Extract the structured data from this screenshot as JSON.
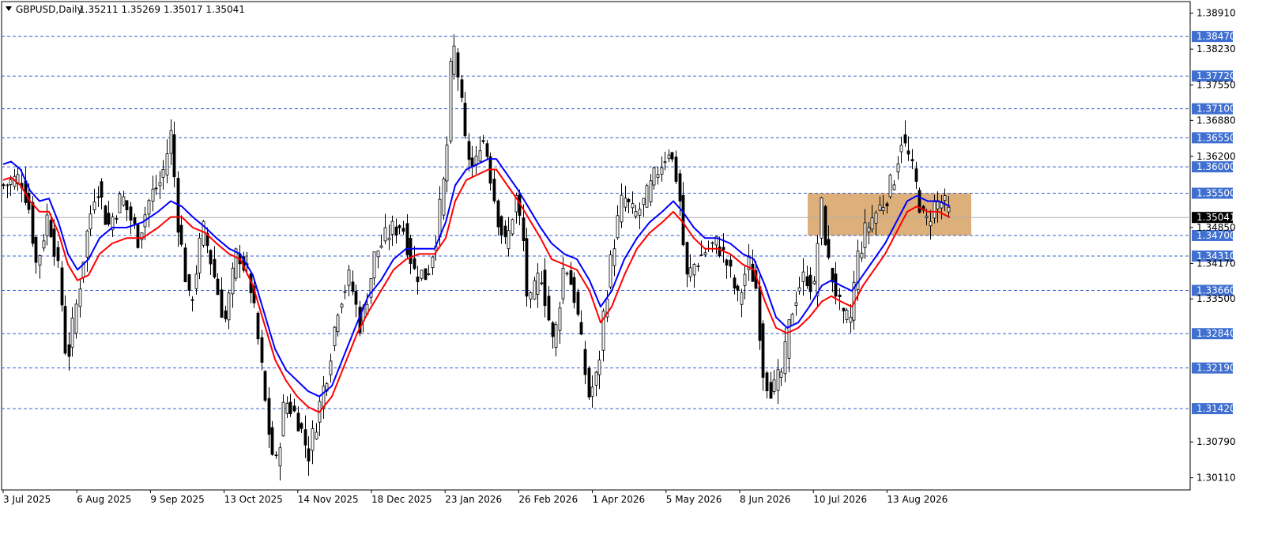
{
  "header": {
    "symbol": "GBPUSD,Daily",
    "ohlc": "1.35211 1.35269 1.35017 1.35041"
  },
  "chart_data": {
    "type": "candlestick",
    "title": "GBPUSD,Daily",
    "ylim": [
      1.2985,
      1.3915
    ],
    "y_ticks": [
      1.3891,
      1.3823,
      1.3755,
      1.3688,
      1.362,
      1.3485,
      1.3417,
      1.335,
      1.3079,
      1.3011
    ],
    "y_tick_labels": [
      "1.38910",
      "1.38230",
      "1.37550",
      "1.36880",
      "1.36200",
      "1.34850",
      "1.34170",
      "1.33500",
      "1.30790",
      "1.30110"
    ],
    "x_tick_labels": [
      "3 Jul 2025",
      "6 Aug 2025",
      "9 Sep 2025",
      "13 Oct 2025",
      "14 Nov 2025",
      "18 Dec 2025",
      "23 Jan 2026",
      "26 Feb 2026",
      "1 Apr 2026",
      "5 May 2026",
      "8 Jun 2026",
      "10 Jul 2026",
      "13 Aug 2026"
    ],
    "horizontal_levels": [
      1.3847,
      1.3772,
      1.371,
      1.3655,
      1.36,
      1.355,
      1.347,
      1.3431,
      1.3366,
      1.3284,
      1.3219,
      1.3142
    ],
    "horizontal_level_labels": [
      "1.38470",
      "1.37720",
      "1.37100",
      "1.36550",
      "1.36000",
      "1.35500",
      "1.34700",
      "1.34310",
      "1.33660",
      "1.32840",
      "1.32190",
      "1.31420"
    ],
    "current_price": 1.35041,
    "current_price_label": "1.35041",
    "zone": {
      "low": 1.347,
      "high": 1.355,
      "color": "#d9a66b"
    },
    "close_path": [
      [
        0,
        1.3565
      ],
      [
        14,
        1.3575
      ],
      [
        22,
        1.358
      ],
      [
        32,
        1.3525
      ],
      [
        42,
        1.341
      ],
      [
        56,
        1.351
      ],
      [
        64,
        1.3455
      ],
      [
        72,
        1.337
      ],
      [
        80,
        1.3225
      ],
      [
        96,
        1.3375
      ],
      [
        104,
        1.346
      ],
      [
        118,
        1.3575
      ],
      [
        132,
        1.3485
      ],
      [
        150,
        1.3545
      ],
      [
        170,
        1.3465
      ],
      [
        186,
        1.3545
      ],
      [
        200,
        1.3575
      ],
      [
        212,
        1.3665
      ],
      [
        220,
        1.3505
      ],
      [
        236,
        1.333
      ],
      [
        252,
        1.3485
      ],
      [
        262,
        1.3425
      ],
      [
        280,
        1.3305
      ],
      [
        296,
        1.3445
      ],
      [
        312,
        1.338
      ],
      [
        324,
        1.325
      ],
      [
        334,
        1.3115
      ],
      [
        344,
        1.3025
      ],
      [
        356,
        1.316
      ],
      [
        372,
        1.3125
      ],
      [
        386,
        1.3055
      ],
      [
        398,
        1.3135
      ],
      [
        410,
        1.3215
      ],
      [
        424,
        1.3345
      ],
      [
        438,
        1.339
      ],
      [
        452,
        1.3295
      ],
      [
        470,
        1.3435
      ],
      [
        488,
        1.3475
      ],
      [
        504,
        1.3495
      ],
      [
        520,
        1.34
      ],
      [
        536,
        1.3395
      ],
      [
        548,
        1.3475
      ],
      [
        560,
        1.3605
      ],
      [
        568,
        1.3845
      ],
      [
        576,
        1.3765
      ],
      [
        584,
        1.3645
      ],
      [
        596,
        1.3585
      ],
      [
        604,
        1.3665
      ],
      [
        612,
        1.3625
      ],
      [
        624,
        1.3515
      ],
      [
        636,
        1.3445
      ],
      [
        648,
        1.3545
      ],
      [
        658,
        1.3455
      ],
      [
        664,
        1.3325
      ],
      [
        680,
        1.3405
      ],
      [
        696,
        1.3255
      ],
      [
        710,
        1.3425
      ],
      [
        724,
        1.3345
      ],
      [
        740,
        1.3165
      ],
      [
        752,
        1.3205
      ],
      [
        760,
        1.3335
      ],
      [
        772,
        1.3455
      ],
      [
        784,
        1.3545
      ],
      [
        798,
        1.3505
      ],
      [
        812,
        1.3535
      ],
      [
        828,
        1.3595
      ],
      [
        842,
        1.3635
      ],
      [
        854,
        1.3565
      ],
      [
        864,
        1.3385
      ],
      [
        876,
        1.342
      ],
      [
        890,
        1.3445
      ],
      [
        904,
        1.3455
      ],
      [
        916,
        1.3415
      ],
      [
        930,
        1.3345
      ],
      [
        942,
        1.342
      ],
      [
        952,
        1.3375
      ],
      [
        962,
        1.3205
      ],
      [
        974,
        1.3175
      ],
      [
        986,
        1.3215
      ],
      [
        996,
        1.332
      ],
      [
        1006,
        1.3375
      ],
      [
        1016,
        1.3395
      ],
      [
        1026,
        1.3365
      ],
      [
        1034,
        1.3535
      ],
      [
        1044,
        1.3415
      ],
      [
        1052,
        1.3375
      ],
      [
        1062,
        1.3305
      ],
      [
        1072,
        1.3315
      ],
      [
        1080,
        1.3425
      ],
      [
        1090,
        1.3475
      ],
      [
        1100,
        1.3505
      ],
      [
        1114,
        1.3535
      ],
      [
        1126,
        1.3575
      ],
      [
        1136,
        1.3655
      ],
      [
        1146,
        1.3615
      ],
      [
        1156,
        1.3555
      ],
      [
        1166,
        1.3485
      ],
      [
        1176,
        1.3525
      ],
      [
        1188,
        1.3535
      ],
      [
        1198,
        1.3504
      ]
    ],
    "series": [
      {
        "color": "#0000ff",
        "values": [
          [
            0,
            1.3605
          ],
          [
            10,
            1.361
          ],
          [
            22,
            1.3595
          ],
          [
            34,
            1.3555
          ],
          [
            46,
            1.3535
          ],
          [
            58,
            1.354
          ],
          [
            70,
            1.3495
          ],
          [
            82,
            1.3435
          ],
          [
            94,
            1.3405
          ],
          [
            108,
            1.3425
          ],
          [
            122,
            1.3465
          ],
          [
            138,
            1.3485
          ],
          [
            156,
            1.3485
          ],
          [
            176,
            1.3495
          ],
          [
            196,
            1.3515
          ],
          [
            212,
            1.3535
          ],
          [
            226,
            1.3525
          ],
          [
            240,
            1.3505
          ],
          [
            256,
            1.3485
          ],
          [
            270,
            1.3465
          ],
          [
            286,
            1.3445
          ],
          [
            300,
            1.3435
          ],
          [
            316,
            1.3395
          ],
          [
            330,
            1.3325
          ],
          [
            344,
            1.3255
          ],
          [
            358,
            1.3215
          ],
          [
            372,
            1.3195
          ],
          [
            386,
            1.3175
          ],
          [
            400,
            1.3165
          ],
          [
            416,
            1.3185
          ],
          [
            432,
            1.3245
          ],
          [
            448,
            1.3305
          ],
          [
            462,
            1.3355
          ],
          [
            478,
            1.3385
          ],
          [
            494,
            1.3425
          ],
          [
            510,
            1.3445
          ],
          [
            526,
            1.3445
          ],
          [
            546,
            1.3445
          ],
          [
            560,
            1.3495
          ],
          [
            572,
            1.3565
          ],
          [
            586,
            1.3595
          ],
          [
            600,
            1.3605
          ],
          [
            614,
            1.3615
          ],
          [
            624,
            1.3615
          ],
          [
            638,
            1.3585
          ],
          [
            652,
            1.3555
          ],
          [
            664,
            1.3525
          ],
          [
            680,
            1.3485
          ],
          [
            694,
            1.3455
          ],
          [
            710,
            1.3435
          ],
          [
            726,
            1.3425
          ],
          [
            742,
            1.3385
          ],
          [
            756,
            1.3335
          ],
          [
            770,
            1.3365
          ],
          [
            786,
            1.3425
          ],
          [
            802,
            1.3465
          ],
          [
            818,
            1.3495
          ],
          [
            834,
            1.3515
          ],
          [
            848,
            1.3535
          ],
          [
            860,
            1.3515
          ],
          [
            874,
            1.3485
          ],
          [
            888,
            1.3465
          ],
          [
            904,
            1.3465
          ],
          [
            920,
            1.3455
          ],
          [
            936,
            1.3435
          ],
          [
            950,
            1.3425
          ],
          [
            964,
            1.3375
          ],
          [
            978,
            1.3315
          ],
          [
            992,
            1.3295
          ],
          [
            1006,
            1.3305
          ],
          [
            1020,
            1.3335
          ],
          [
            1036,
            1.3375
          ],
          [
            1048,
            1.3385
          ],
          [
            1060,
            1.3375
          ],
          [
            1074,
            1.3365
          ],
          [
            1088,
            1.3395
          ],
          [
            1102,
            1.3425
          ],
          [
            1116,
            1.3455
          ],
          [
            1130,
            1.3495
          ],
          [
            1144,
            1.3535
          ],
          [
            1156,
            1.3545
          ],
          [
            1170,
            1.3535
          ],
          [
            1184,
            1.3535
          ],
          [
            1198,
            1.3525
          ]
        ]
      },
      {
        "color": "#ff0000",
        "values": [
          [
            0,
            1.3575
          ],
          [
            10,
            1.358
          ],
          [
            22,
            1.3565
          ],
          [
            34,
            1.3535
          ],
          [
            46,
            1.3515
          ],
          [
            58,
            1.3515
          ],
          [
            70,
            1.3475
          ],
          [
            82,
            1.3415
          ],
          [
            94,
            1.3385
          ],
          [
            108,
            1.3395
          ],
          [
            122,
            1.3435
          ],
          [
            138,
            1.3455
          ],
          [
            156,
            1.3465
          ],
          [
            176,
            1.3465
          ],
          [
            196,
            1.3485
          ],
          [
            212,
            1.3505
          ],
          [
            226,
            1.3505
          ],
          [
            240,
            1.3485
          ],
          [
            256,
            1.3475
          ],
          [
            270,
            1.3455
          ],
          [
            286,
            1.3435
          ],
          [
            300,
            1.3425
          ],
          [
            316,
            1.3375
          ],
          [
            330,
            1.3305
          ],
          [
            344,
            1.3235
          ],
          [
            358,
            1.3195
          ],
          [
            372,
            1.3165
          ],
          [
            386,
            1.3145
          ],
          [
            400,
            1.3135
          ],
          [
            416,
            1.3165
          ],
          [
            432,
            1.3225
          ],
          [
            448,
            1.3285
          ],
          [
            462,
            1.3325
          ],
          [
            478,
            1.3365
          ],
          [
            494,
            1.3405
          ],
          [
            510,
            1.3425
          ],
          [
            526,
            1.3435
          ],
          [
            546,
            1.3435
          ],
          [
            560,
            1.3465
          ],
          [
            572,
            1.3535
          ],
          [
            586,
            1.3575
          ],
          [
            600,
            1.3585
          ],
          [
            614,
            1.3595
          ],
          [
            624,
            1.3595
          ],
          [
            638,
            1.3565
          ],
          [
            652,
            1.3535
          ],
          [
            664,
            1.3505
          ],
          [
            680,
            1.3465
          ],
          [
            694,
            1.3425
          ],
          [
            710,
            1.3415
          ],
          [
            726,
            1.3405
          ],
          [
            742,
            1.3365
          ],
          [
            756,
            1.3305
          ],
          [
            770,
            1.3335
          ],
          [
            786,
            1.3395
          ],
          [
            802,
            1.3445
          ],
          [
            818,
            1.3475
          ],
          [
            834,
            1.3495
          ],
          [
            848,
            1.3515
          ],
          [
            860,
            1.3495
          ],
          [
            874,
            1.3465
          ],
          [
            888,
            1.3445
          ],
          [
            904,
            1.3445
          ],
          [
            920,
            1.3435
          ],
          [
            936,
            1.3415
          ],
          [
            950,
            1.3405
          ],
          [
            964,
            1.3345
          ],
          [
            978,
            1.3295
          ],
          [
            992,
            1.3285
          ],
          [
            1006,
            1.3295
          ],
          [
            1020,
            1.3315
          ],
          [
            1036,
            1.3345
          ],
          [
            1048,
            1.3355
          ],
          [
            1060,
            1.3345
          ],
          [
            1074,
            1.3335
          ],
          [
            1088,
            1.3375
          ],
          [
            1102,
            1.3405
          ],
          [
            1116,
            1.3435
          ],
          [
            1130,
            1.3475
          ],
          [
            1144,
            1.3515
          ],
          [
            1156,
            1.3525
          ],
          [
            1170,
            1.3515
          ],
          [
            1184,
            1.3515
          ],
          [
            1198,
            1.3504
          ]
        ]
      }
    ],
    "grid": false,
    "legend": "none"
  }
}
